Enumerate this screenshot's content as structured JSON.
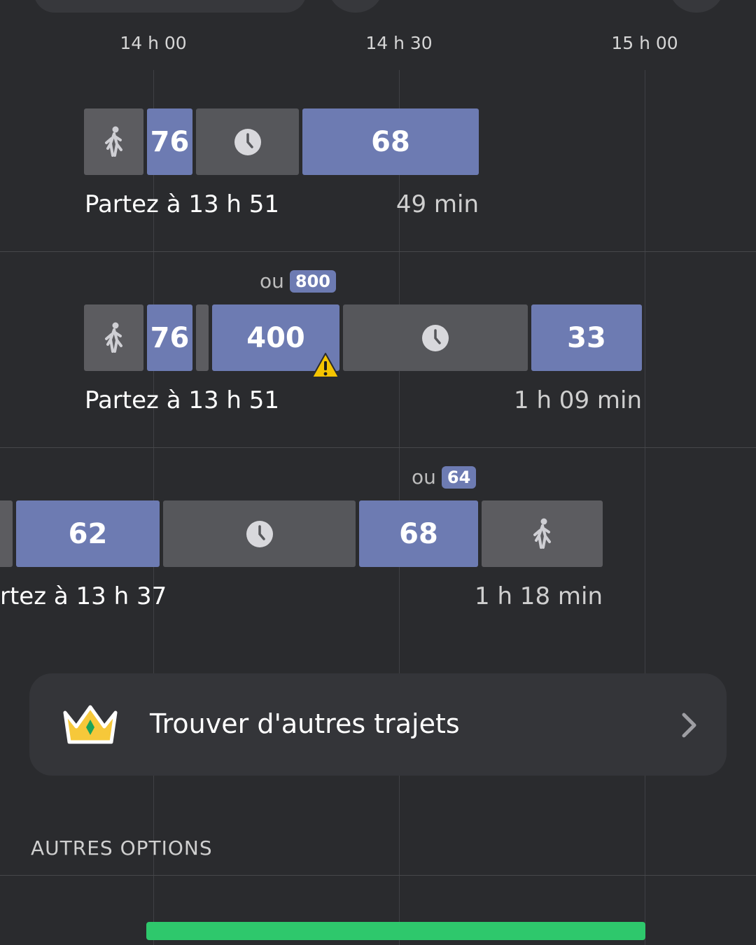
{
  "timeline": {
    "ticks": [
      "14 h 00",
      "14 h 30",
      "15 h 00"
    ]
  },
  "colors": {
    "background": "#2a2b2e",
    "bus_segment": "#6d7bb2",
    "walk_segment": "#5c5c60",
    "wait_segment": "#56575b",
    "card": "#343539",
    "warning": "#f5c400",
    "progress": "#2ec86c"
  },
  "trips": [
    {
      "segments": [
        {
          "type": "walk",
          "icon": "walking-person-icon"
        },
        {
          "type": "bus",
          "label": "76"
        },
        {
          "type": "wait",
          "icon": "clock-icon"
        },
        {
          "type": "bus",
          "label": "68"
        }
      ],
      "depart": "Partez à 13 h 51",
      "duration": "49 min"
    },
    {
      "alternative_prefix": "ou",
      "alternative_route": "800",
      "segments": [
        {
          "type": "walk",
          "icon": "walking-person-icon"
        },
        {
          "type": "bus",
          "label": "76"
        },
        {
          "type": "walk"
        },
        {
          "type": "bus",
          "label": "400",
          "warning_icon": "warning-icon"
        },
        {
          "type": "wait",
          "icon": "clock-icon"
        },
        {
          "type": "bus",
          "label": "33"
        }
      ],
      "depart": "Partez à 13 h 51",
      "duration": "1 h 09 min"
    },
    {
      "alternative_prefix": "ou",
      "alternative_route": "64",
      "segments": [
        {
          "type": "walk"
        },
        {
          "type": "bus",
          "label": "62"
        },
        {
          "type": "wait",
          "icon": "clock-icon"
        },
        {
          "type": "bus",
          "label": "68"
        },
        {
          "type": "walk",
          "icon": "walking-person-icon"
        }
      ],
      "depart": "rtez à 13 h 37",
      "duration": "1 h 18 min"
    }
  ],
  "find_more": {
    "label": "Trouver d'autres trajets",
    "icon": "crown-icon",
    "chevron": "chevron-right-icon"
  },
  "other_options": {
    "title": "AUTRES OPTIONS"
  }
}
